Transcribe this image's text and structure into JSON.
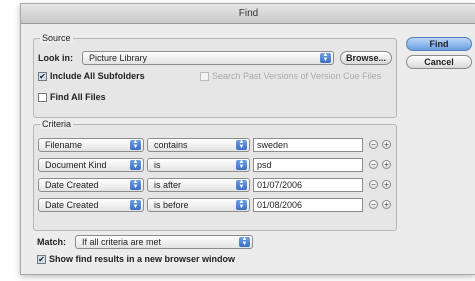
{
  "window": {
    "title": "Find"
  },
  "buttons": {
    "find": "Find",
    "cancel": "Cancel"
  },
  "source": {
    "group_title": "Source",
    "look_in_label": "Look in:",
    "look_in_value": "Picture Library",
    "browse": "Browse...",
    "include_subfolders": {
      "label": "Include All Subfolders",
      "checked": true
    },
    "search_past_versions": {
      "label": "Search Past Versions of Version Cue Files",
      "checked": false,
      "enabled": false
    },
    "find_all_files": {
      "label": "Find All Files",
      "checked": false
    }
  },
  "criteria": {
    "group_title": "Criteria",
    "rows": [
      {
        "field": "Filename",
        "operator": "contains",
        "value": "sweden"
      },
      {
        "field": "Document Kind",
        "operator": "is",
        "value": "psd"
      },
      {
        "field": "Date Created",
        "operator": "is after",
        "value": "01/07/2006"
      },
      {
        "field": "Date Created",
        "operator": "is before",
        "value": "01/08/2006"
      }
    ]
  },
  "match": {
    "label": "Match:",
    "value": "If all criteria are met"
  },
  "show_results": {
    "label": "Show find results in a new browser window",
    "checked": true
  },
  "icons": {
    "popup_arrows": "updown-arrows-icon",
    "remove": "minus-circle-icon",
    "add": "plus-circle-icon",
    "check": "checkmark-icon"
  }
}
